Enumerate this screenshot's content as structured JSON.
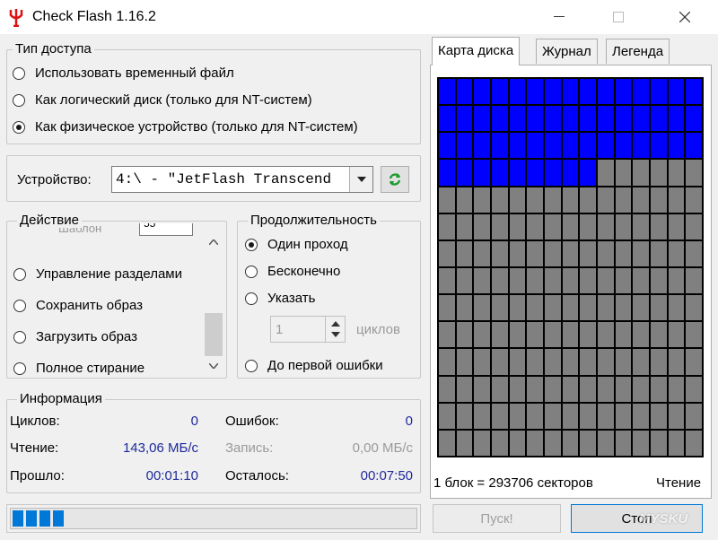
{
  "window": {
    "title": "Check Flash 1.16.2",
    "icon": "usb-trident-icon"
  },
  "access": {
    "legend": "Тип доступа",
    "options": [
      {
        "label": "Использовать временный файл",
        "selected": false
      },
      {
        "label": "Как логический диск (только для NT-систем)",
        "selected": false
      },
      {
        "label": "Как физическое устройство (только для NT-систем)",
        "selected": true
      }
    ]
  },
  "device": {
    "label": "Устройство:",
    "value": "4:\\ - \"JetFlash Transcend"
  },
  "action": {
    "legend": "Действие",
    "partial_label": "Шаблон",
    "partial_value": "55",
    "options": [
      {
        "label": "Управление разделами",
        "selected": false
      },
      {
        "label": "Сохранить образ",
        "selected": false
      },
      {
        "label": "Загрузить образ",
        "selected": false
      },
      {
        "label": "Полное стирание",
        "selected": false
      }
    ]
  },
  "duration": {
    "legend": "Продолжительность",
    "options": [
      {
        "label": "Один проход",
        "selected": true
      },
      {
        "label": "Бесконечно",
        "selected": false
      },
      {
        "label": "Указать",
        "selected": false
      },
      {
        "label": "До первой ошибки",
        "selected": false
      }
    ],
    "cycles_value": "1",
    "cycles_label": "циклов"
  },
  "info": {
    "legend": "Информация",
    "cycles_label": "Циклов:",
    "cycles_value": "0",
    "errors_label": "Ошибок:",
    "errors_value": "0",
    "read_label": "Чтение:",
    "read_value": "143,06 МБ/с",
    "write_label": "Запись:",
    "write_value": "0,00 МБ/с",
    "elapsed_label": "Прошло:",
    "elapsed_value": "00:01:10",
    "remaining_label": "Осталось:",
    "remaining_value": "00:07:50"
  },
  "progress": {
    "segments_filled": 4
  },
  "tabs": [
    {
      "label": "Карта диска",
      "active": true
    },
    {
      "label": "Журнал",
      "active": false
    },
    {
      "label": "Легенда",
      "active": false
    }
  ],
  "disk_map": {
    "columns": 15,
    "rows": 14,
    "used_cells": 54,
    "colors": {
      "used": "#0000ff",
      "unused": "#808080",
      "border": "#000000"
    }
  },
  "status": {
    "block_info": "1 блок = 293706 секторов",
    "mode": "Чтение"
  },
  "buttons": {
    "start": "Пуск!",
    "stop": "Стоп"
  },
  "watermark": "MYSKU"
}
